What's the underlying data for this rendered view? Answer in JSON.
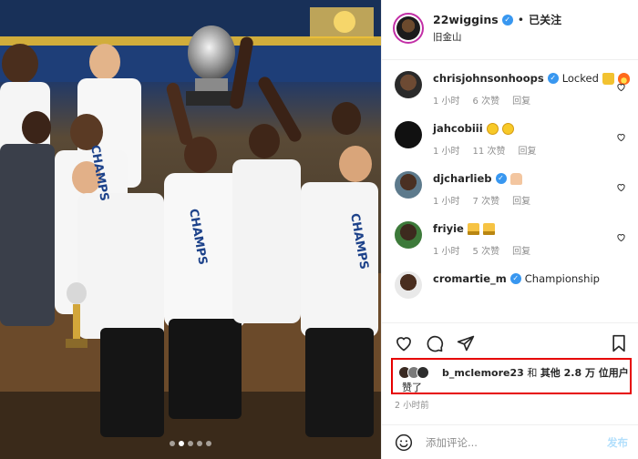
{
  "photo": {
    "alt_scene": "",
    "carousel_dots": 5,
    "active_dot": 1,
    "jersey_words": [
      "CHAMPS",
      "CHAMPS",
      "CHAMPS"
    ]
  },
  "header": {
    "username": "22wiggins",
    "separator": "•",
    "follow_status": "已关注",
    "location": "旧金山",
    "more": "···"
  },
  "comments": [
    {
      "name": "chrisjohnsonhoops",
      "verified": true,
      "text": "Locked",
      "emoji": [
        "lock",
        "fire"
      ],
      "time": "1 小时",
      "likes": "6 次赞",
      "reply": "回复"
    },
    {
      "name": "jahcobiii",
      "verified": false,
      "text": "",
      "emoji": [
        "grin",
        "grin"
      ],
      "time": "1 小时",
      "likes": "11 次赞",
      "reply": "回复"
    },
    {
      "name": "djcharlieb",
      "verified": true,
      "text": "",
      "emoji": [
        "hands"
      ],
      "time": "1 小时",
      "likes": "7 次赞",
      "reply": "回复"
    },
    {
      "name": "friyie",
      "verified": false,
      "text": "",
      "emoji": [
        "trophy",
        "trophy"
      ],
      "time": "1 小时",
      "likes": "5 次赞",
      "reply": "回复"
    },
    {
      "name": "cromartie_m",
      "verified": false,
      "text": "Championship",
      "emoji": [],
      "time": "",
      "likes": "",
      "reply": ""
    }
  ],
  "actions": {
    "like_icon": "heart-icon",
    "comment_icon": "comment-icon",
    "share_icon": "share-icon",
    "save_icon": "bookmark-icon"
  },
  "likes_summary": {
    "user": "b_mclemore23",
    "connector": "和",
    "others": "其他 2.8 万 位用户",
    "suffix": "赞了"
  },
  "post_time": "2 小时前",
  "add_comment": {
    "placeholder": "添加评论...",
    "post_label": "发布"
  },
  "colors": {
    "verified": "#3897f0",
    "highlight_border": "#e60000",
    "post_disabled": "#b2dffc",
    "muted": "#8e8e8e"
  }
}
